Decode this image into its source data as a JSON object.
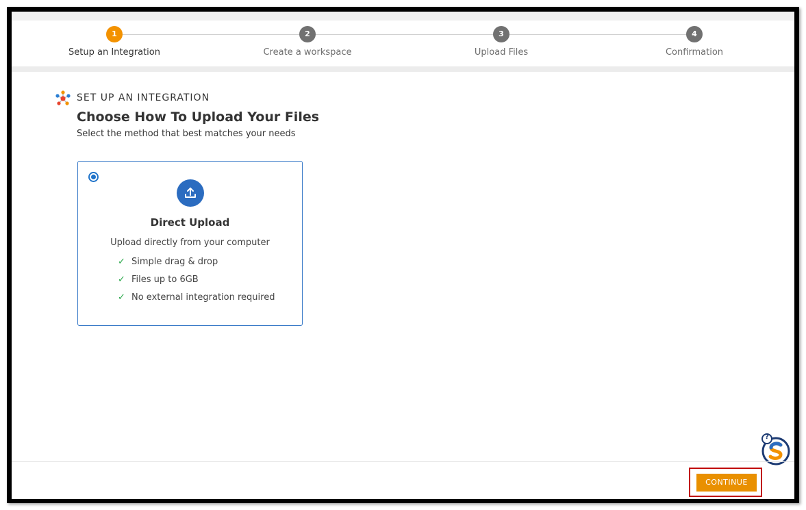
{
  "stepper": {
    "steps": [
      {
        "number": "1",
        "label": "Setup an Integration",
        "active": true
      },
      {
        "number": "2",
        "label": "Create a workspace",
        "active": false
      },
      {
        "number": "3",
        "label": "Upload Files",
        "active": false
      },
      {
        "number": "4",
        "label": "Confirmation",
        "active": false
      }
    ]
  },
  "section": {
    "label": "SET UP AN INTEGRATION",
    "icon": "integration-hub-icon",
    "title": "Choose How To Upload Your Files",
    "subtitle": "Select the method that best matches your needs"
  },
  "option_card": {
    "selected": true,
    "icon": "upload-icon",
    "title": "Direct Upload",
    "description": "Upload directly from your computer",
    "features": [
      "Simple drag & drop",
      "Files up to 6GB",
      "No external integration required"
    ]
  },
  "footer": {
    "continue_label": "CONTINUE"
  },
  "help_widget": {
    "badge": "?",
    "icon": "help-assistant-icon"
  },
  "colors": {
    "active_step": "#f39200",
    "inactive_step": "#717171",
    "primary_blue": "#2b6cc0",
    "continue_button": "#e99000",
    "highlight_border": "#c00000",
    "check_green": "#2aa84a"
  }
}
